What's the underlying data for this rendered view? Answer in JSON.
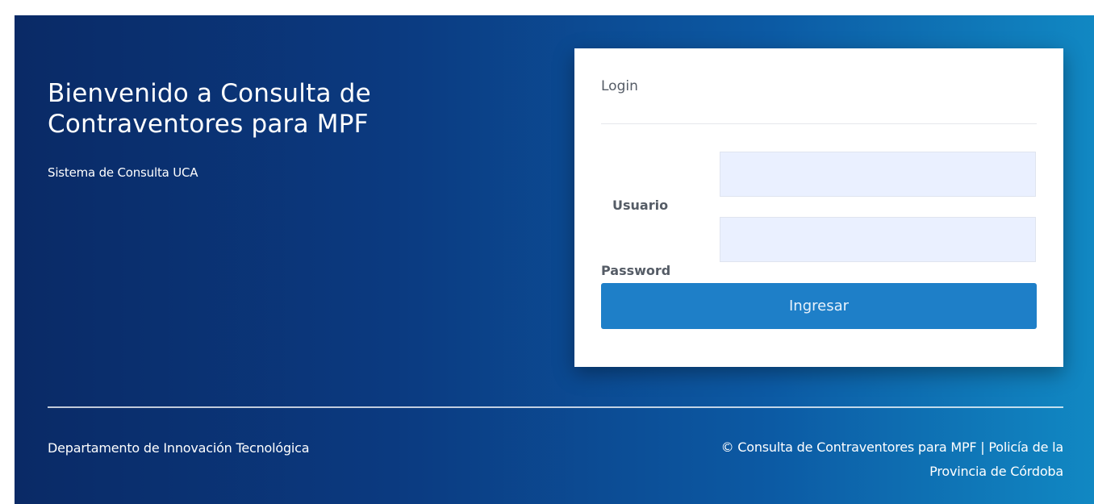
{
  "header": {
    "title": "Bienvenido a Consulta de Contraventores para MPF",
    "subtitle": "Sistema de Consulta UCA"
  },
  "login": {
    "title": "Login",
    "username_label": "Usuario",
    "username_value": "",
    "password_label": "Password",
    "password_value": "",
    "submit_label": "Ingresar"
  },
  "footer": {
    "left_text": "Departamento de Innovación Tecnológica",
    "copyright_line1": "© Consulta de Contraventores para MPF | Policía de la",
    "copyright_line2": "Provincia de Córdoba"
  },
  "colors": {
    "background_start": "#0a2a66",
    "background_end": "#1188c3",
    "button": "#1e7fc8",
    "input_background": "#eaf0ff"
  }
}
